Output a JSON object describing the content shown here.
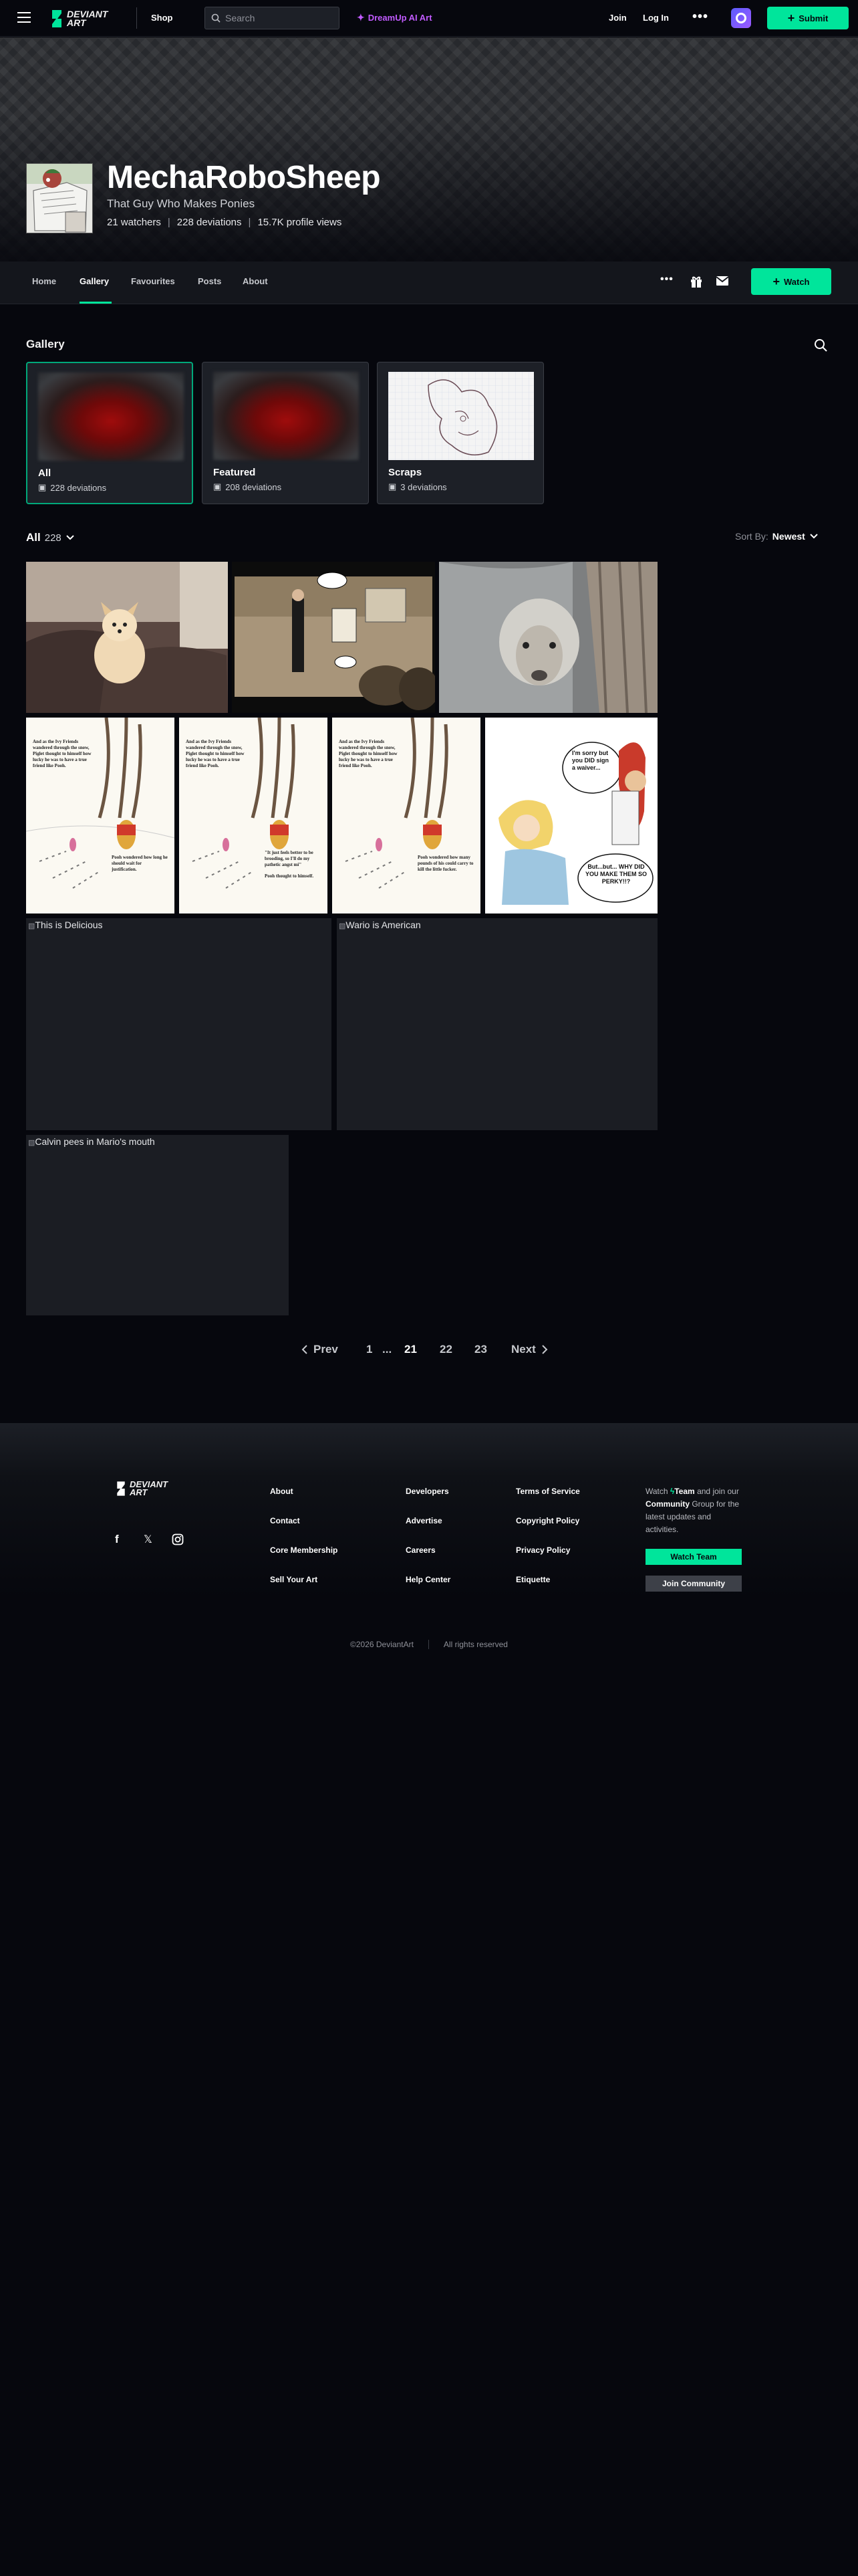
{
  "header": {
    "brand": "DEVIANTART",
    "brand_line1": "DEVIANT",
    "brand_line2": "ART",
    "shop": "Shop",
    "search_placeholder": "Search",
    "dreamup": "DreamUp AI Art",
    "join": "Join",
    "login": "Log In",
    "submit": "Submit",
    "accent_color": "#00e59b",
    "dreamup_color": "#c15bff"
  },
  "profile": {
    "username": "MechaRoboSheep",
    "tagline": "That Guy Who Makes Ponies",
    "stats": {
      "watchers": "21 watchers",
      "deviations": "228 deviations",
      "views": "15.7K profile views"
    }
  },
  "tabs": [
    "Home",
    "Gallery",
    "Favourites",
    "Posts",
    "About"
  ],
  "watch_label": "Watch",
  "gallery": {
    "title": "Gallery",
    "folders": [
      {
        "name": "All",
        "count": "228 deviations"
      },
      {
        "name": "Featured",
        "count": "208 deviations"
      },
      {
        "name": "Scraps",
        "count": "3 deviations"
      }
    ],
    "filter_label": "All",
    "filter_count": "228",
    "sort_label": "Sort By:",
    "sort_value": "Newest"
  },
  "comic_text": {
    "pooh_caption": "And as the Ivy Friends wandered through the snow, Piglet thought to himself how lucky he was to have a true friend like Pooh.",
    "pooh_end_1": "Pooh wondered how long he should wait for justification.",
    "pooh_end_2": "\"It just feels better to be brooding, so I'll do my pathetic angst mi\"",
    "pooh_end_2b": "Pooh thought to himself.",
    "pooh_end_3": "Pooh wondered how many pounds of his could carry to kill the little fucker.",
    "nurse_bubble_1": "I'm sorry but you DID sign a waiver...",
    "nurse_bubble_2": "But...but... WHY DID YOU MAKE THEM SO PERKY!!?"
  },
  "broken_images": {
    "a": "This is Delicious",
    "b": "Wario is American",
    "c": "Calvin pees in Mario's mouth"
  },
  "pagination": {
    "prev": "Prev",
    "first": "1",
    "ellipsis": "...",
    "current": "21",
    "p22": "22",
    "p23": "23",
    "next": "Next"
  },
  "footer": {
    "col1": [
      "About",
      "Contact",
      "Core Membership",
      "Sell Your Art"
    ],
    "col2": [
      "Developers",
      "Advertise",
      "Careers",
      "Help Center"
    ],
    "col3": [
      "Terms of Service",
      "Copyright Policy",
      "Privacy Policy",
      "Etiquette"
    ],
    "promo_watch": "Watch",
    "promo_team": "Team",
    "promo_and": "and",
    "promo_join_our": "join our",
    "promo_community": "Community",
    "promo_rest": "Group for the latest updates and activities.",
    "watch_team": "Watch Team",
    "join_community": "Join Community",
    "copyright": "©2026 DeviantArt",
    "rights": "All rights reserved"
  }
}
